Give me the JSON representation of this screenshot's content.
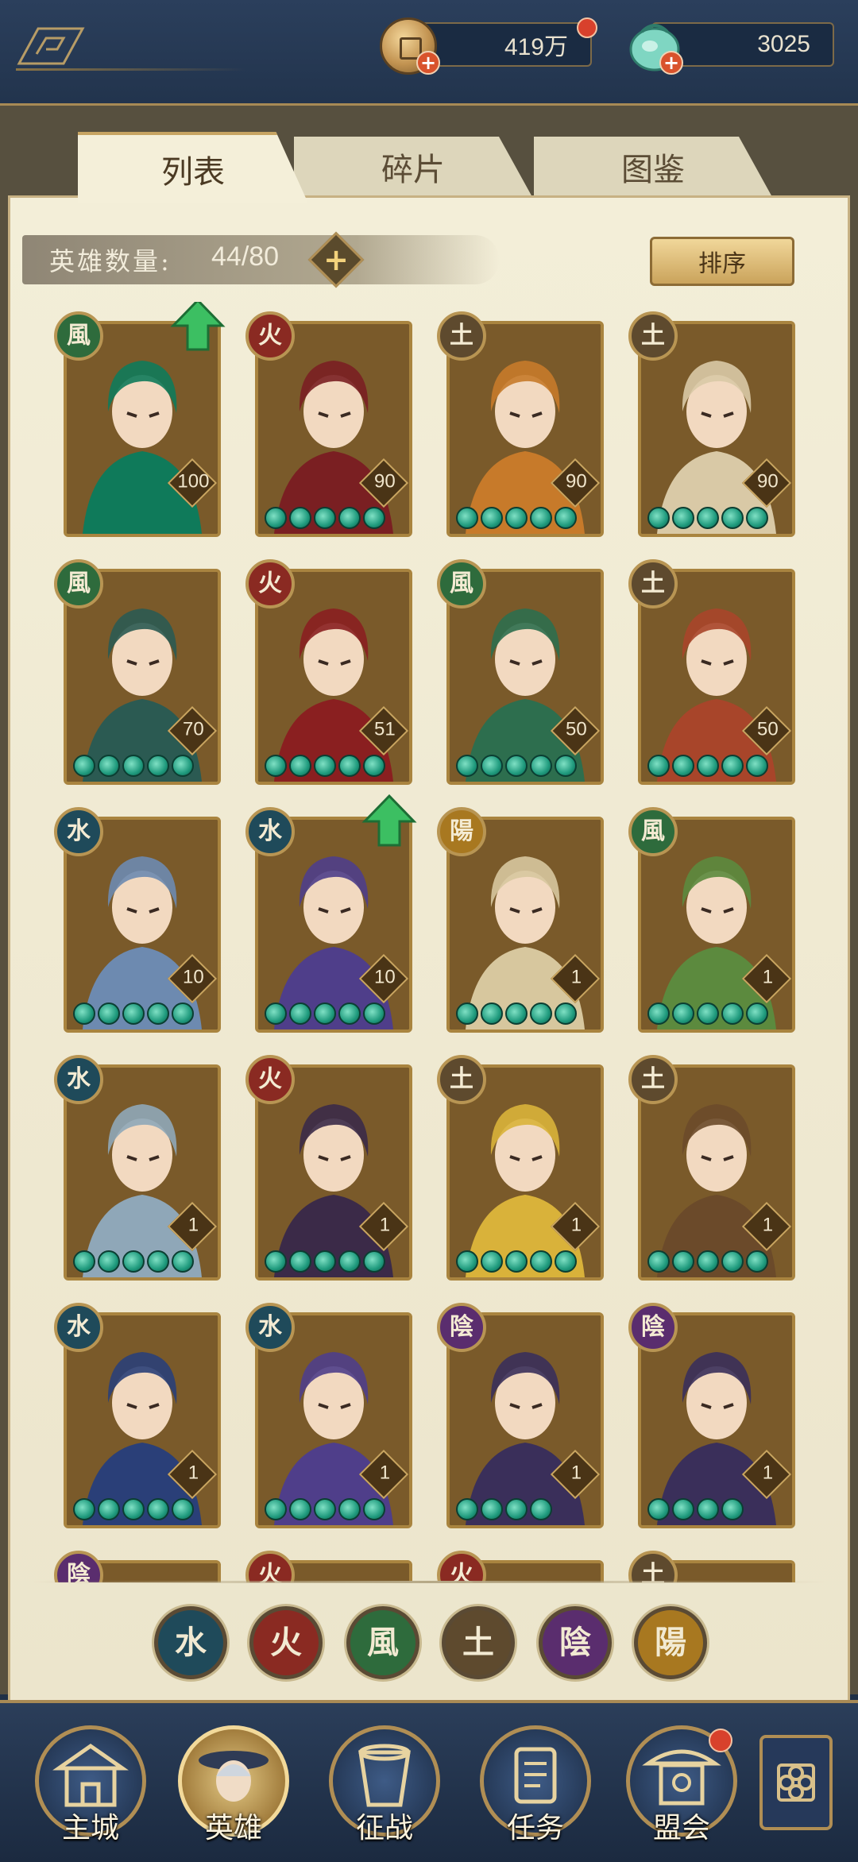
{
  "currencies": {
    "coins": "419万",
    "jade": "3025"
  },
  "tabs": [
    {
      "label": "列表",
      "active": true
    },
    {
      "label": "碎片",
      "active": false
    },
    {
      "label": "图鉴",
      "active": false
    }
  ],
  "hero_count": {
    "label": "英雄数量:",
    "value": "44/80"
  },
  "sort_label": "排序",
  "heroes": [
    {
      "element": "風",
      "level": "100",
      "stars": 0,
      "upgrade": true,
      "color": "#0f7a5a",
      "badge": "#2e6b3c"
    },
    {
      "element": "火",
      "level": "90",
      "stars": 5,
      "upgrade": false,
      "color": "#7a1f22",
      "badge": "#8a2a22"
    },
    {
      "element": "土",
      "level": "90",
      "stars": 5,
      "upgrade": false,
      "color": "#c77a2a",
      "badge": "#5e4a2e"
    },
    {
      "element": "土",
      "level": "90",
      "stars": 5,
      "upgrade": false,
      "color": "#d9c9a6",
      "badge": "#5e4a2e"
    },
    {
      "element": "風",
      "level": "70",
      "stars": 5,
      "upgrade": false,
      "color": "#2b5a52",
      "badge": "#2e6b3c"
    },
    {
      "element": "火",
      "level": "51",
      "stars": 5,
      "upgrade": false,
      "color": "#8a1f20",
      "badge": "#8a2a22"
    },
    {
      "element": "風",
      "level": "50",
      "stars": 5,
      "upgrade": false,
      "color": "#2d6e4e",
      "badge": "#2e6b3c"
    },
    {
      "element": "土",
      "level": "50",
      "stars": 5,
      "upgrade": false,
      "color": "#a8452a",
      "badge": "#5e4a2e"
    },
    {
      "element": "水",
      "level": "10",
      "stars": 5,
      "upgrade": false,
      "color": "#6d8ab0",
      "badge": "#1f4a5a"
    },
    {
      "element": "水",
      "level": "10",
      "stars": 5,
      "upgrade": true,
      "color": "#4f3e8a",
      "badge": "#1f4a5a"
    },
    {
      "element": "陽",
      "level": "1",
      "stars": 5,
      "upgrade": false,
      "color": "#d7c79e",
      "badge": "#a87820"
    },
    {
      "element": "風",
      "level": "1",
      "stars": 5,
      "upgrade": false,
      "color": "#5c8a3e",
      "badge": "#2e6b3c"
    },
    {
      "element": "水",
      "level": "1",
      "stars": 5,
      "upgrade": false,
      "color": "#8fa7b8",
      "badge": "#1f4a5a"
    },
    {
      "element": "火",
      "level": "1",
      "stars": 5,
      "upgrade": false,
      "color": "#3b2a48",
      "badge": "#8a2a22"
    },
    {
      "element": "土",
      "level": "1",
      "stars": 5,
      "upgrade": false,
      "color": "#d9b23a",
      "badge": "#5e4a2e"
    },
    {
      "element": "土",
      "level": "1",
      "stars": 5,
      "upgrade": false,
      "color": "#6b4a2a",
      "badge": "#5e4a2e"
    },
    {
      "element": "水",
      "level": "1",
      "stars": 5,
      "upgrade": false,
      "color": "#2a3f78",
      "badge": "#1f4a5a"
    },
    {
      "element": "水",
      "level": "1",
      "stars": 5,
      "upgrade": false,
      "color": "#4f3e8a",
      "badge": "#1f4a5a"
    },
    {
      "element": "陰",
      "level": "1",
      "stars": 4,
      "upgrade": false,
      "color": "#3a2f5a",
      "badge": "#5a2d6e"
    },
    {
      "element": "陰",
      "level": "1",
      "stars": 4,
      "upgrade": false,
      "color": "#3a2f5a",
      "badge": "#5a2d6e"
    },
    {
      "element": "陰",
      "level": "",
      "stars": 0,
      "upgrade": false,
      "color": "#3a2f5a",
      "badge": "#5a2d6e"
    },
    {
      "element": "火",
      "level": "",
      "stars": 0,
      "upgrade": false,
      "color": "#6b2a22",
      "badge": "#8a2a22"
    },
    {
      "element": "火",
      "level": "",
      "stars": 0,
      "upgrade": false,
      "color": "#6b2a22",
      "badge": "#8a2a22"
    },
    {
      "element": "土",
      "level": "",
      "stars": 0,
      "upgrade": false,
      "color": "#6b4a2a",
      "badge": "#5e4a2e"
    }
  ],
  "element_filters": [
    {
      "glyph": "水",
      "name": "water",
      "color": "#1f4a5a"
    },
    {
      "glyph": "火",
      "name": "fire",
      "color": "#8a2a22"
    },
    {
      "glyph": "風",
      "name": "wind",
      "color": "#2e6b3c"
    },
    {
      "glyph": "土",
      "name": "earth",
      "color": "#5e4a2e"
    },
    {
      "glyph": "陰",
      "name": "yin",
      "color": "#5a2d6e"
    },
    {
      "glyph": "陽",
      "name": "yang",
      "color": "#a87820"
    }
  ],
  "nav": [
    {
      "label": "主城",
      "icon": "city-gate-icon",
      "active": false
    },
    {
      "label": "英雄",
      "icon": "hero-portrait-icon",
      "active": true
    },
    {
      "label": "征战",
      "icon": "battle-drum-icon",
      "active": false
    },
    {
      "label": "任务",
      "icon": "task-scroll-icon",
      "active": false
    },
    {
      "label": "盟会",
      "icon": "guild-pavilion-icon",
      "active": false
    }
  ],
  "more_icon": "flower-grid-icon"
}
